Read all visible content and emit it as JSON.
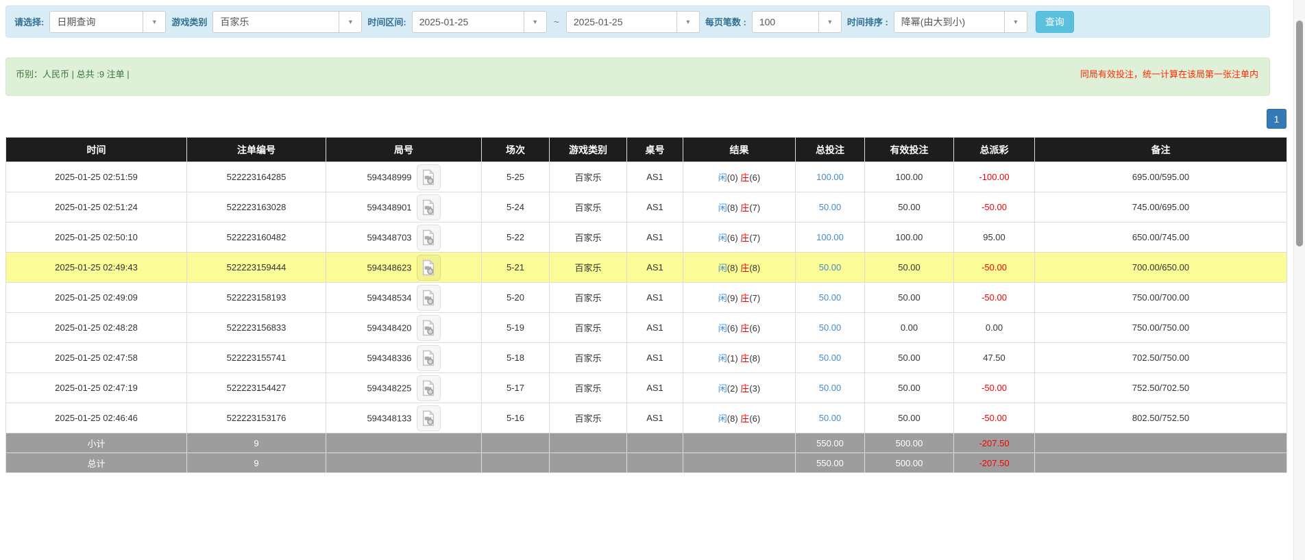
{
  "filter_bar": {
    "select_type": {
      "label": "请选择:",
      "value": "日期查询"
    },
    "game_category": {
      "label": "游戏类别",
      "value": "百家乐"
    },
    "time_range": {
      "label": "时间区间:",
      "from": "2025-01-25",
      "separator": "~",
      "to": "2025-01-25"
    },
    "page_size": {
      "label": "每页笔数 :",
      "value": "100"
    },
    "time_sort": {
      "label": "时间排序 :",
      "value": "降幂(由大到小)"
    },
    "query_button": "查询"
  },
  "summary_bar": {
    "left_text": "币别：人民币 | 总共 :9 注单 |",
    "right_notice": "同局有效投注，统一计算在该局第一张注单内"
  },
  "pagination": {
    "current_page": "1"
  },
  "icons": {
    "round_video": "video-replay-icon",
    "select_arrow": "chevron-down-icon"
  },
  "colors": {
    "filter_bg": "#d9edf7",
    "summary_bg": "#dff0d8",
    "notice_red": "#ff2a00",
    "header_bg": "#1d1d1d",
    "highlight_row": "#fbfb98",
    "summary_row_bg": "#9d9d9d",
    "link_blue": "#428bca",
    "negative_red": "#f50000",
    "query_btn": "#5bc0de",
    "page_btn": "#337ab7"
  },
  "table": {
    "headers": [
      "时间",
      "注单编号",
      "局号",
      "场次",
      "游戏类别",
      "桌号",
      "结果",
      "总投注",
      "有效投注",
      "总派彩",
      "备注"
    ],
    "rows": [
      {
        "time": "2025-01-25 02:51:59",
        "bet_no": "522223164285",
        "round_no": "594348999",
        "session": "5-25",
        "game": "百家乐",
        "table_no": "AS1",
        "player": "闲",
        "player_pts": "(0)",
        "banker": "庄",
        "banker_pts": "(6)",
        "total_bet": "100.00",
        "valid_bet": "100.00",
        "payout": "-100.00",
        "remark": "695.00/595.00",
        "highlighted": false
      },
      {
        "time": "2025-01-25 02:51:24",
        "bet_no": "522223163028",
        "round_no": "594348901",
        "session": "5-24",
        "game": "百家乐",
        "table_no": "AS1",
        "player": "闲",
        "player_pts": "(8)",
        "banker": "庄",
        "banker_pts": "(7)",
        "total_bet": "50.00",
        "valid_bet": "50.00",
        "payout": "-50.00",
        "remark": "745.00/695.00",
        "highlighted": false
      },
      {
        "time": "2025-01-25 02:50:10",
        "bet_no": "522223160482",
        "round_no": "594348703",
        "session": "5-22",
        "game": "百家乐",
        "table_no": "AS1",
        "player": "闲",
        "player_pts": "(6)",
        "banker": "庄",
        "banker_pts": "(7)",
        "total_bet": "100.00",
        "valid_bet": "100.00",
        "payout": "95.00",
        "remark": "650.00/745.00",
        "highlighted": false
      },
      {
        "time": "2025-01-25 02:49:43",
        "bet_no": "522223159444",
        "round_no": "594348623",
        "session": "5-21",
        "game": "百家乐",
        "table_no": "AS1",
        "player": "闲",
        "player_pts": "(8)",
        "banker": "庄",
        "banker_pts": "(8)",
        "total_bet": "50.00",
        "valid_bet": "50.00",
        "payout": "-50.00",
        "remark": "700.00/650.00",
        "highlighted": true
      },
      {
        "time": "2025-01-25 02:49:09",
        "bet_no": "522223158193",
        "round_no": "594348534",
        "session": "5-20",
        "game": "百家乐",
        "table_no": "AS1",
        "player": "闲",
        "player_pts": "(9)",
        "banker": "庄",
        "banker_pts": "(7)",
        "total_bet": "50.00",
        "valid_bet": "50.00",
        "payout": "-50.00",
        "remark": "750.00/700.00",
        "highlighted": false
      },
      {
        "time": "2025-01-25 02:48:28",
        "bet_no": "522223156833",
        "round_no": "594348420",
        "session": "5-19",
        "game": "百家乐",
        "table_no": "AS1",
        "player": "闲",
        "player_pts": "(6)",
        "banker": "庄",
        "banker_pts": "(6)",
        "total_bet": "50.00",
        "valid_bet": "0.00",
        "payout": "0.00",
        "remark": "750.00/750.00",
        "highlighted": false
      },
      {
        "time": "2025-01-25 02:47:58",
        "bet_no": "522223155741",
        "round_no": "594348336",
        "session": "5-18",
        "game": "百家乐",
        "table_no": "AS1",
        "player": "闲",
        "player_pts": "(1)",
        "banker": "庄",
        "banker_pts": "(8)",
        "total_bet": "50.00",
        "valid_bet": "50.00",
        "payout": "47.50",
        "remark": "702.50/750.00",
        "highlighted": false
      },
      {
        "time": "2025-01-25 02:47:19",
        "bet_no": "522223154427",
        "round_no": "594348225",
        "session": "5-17",
        "game": "百家乐",
        "table_no": "AS1",
        "player": "闲",
        "player_pts": "(2)",
        "banker": "庄",
        "banker_pts": "(3)",
        "total_bet": "50.00",
        "valid_bet": "50.00",
        "payout": "-50.00",
        "remark": "752.50/702.50",
        "highlighted": false
      },
      {
        "time": "2025-01-25 02:46:46",
        "bet_no": "522223153176",
        "round_no": "594348133",
        "session": "5-16",
        "game": "百家乐",
        "table_no": "AS1",
        "player": "闲",
        "player_pts": "(8)",
        "banker": "庄",
        "banker_pts": "(6)",
        "total_bet": "50.00",
        "valid_bet": "50.00",
        "payout": "-50.00",
        "remark": "802.50/752.50",
        "highlighted": false
      }
    ],
    "subtotal": {
      "label": "小计",
      "count": "9",
      "total_bet": "550.00",
      "valid_bet": "500.00",
      "payout": "-207.50"
    },
    "grand_total": {
      "label": "总计",
      "count": "9",
      "total_bet": "550.00",
      "valid_bet": "500.00",
      "payout": "-207.50"
    }
  }
}
